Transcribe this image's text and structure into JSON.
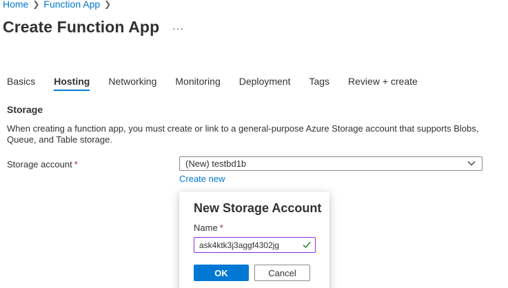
{
  "breadcrumb": {
    "items": [
      "Home",
      "Function App"
    ]
  },
  "header": {
    "title": "Create Function App",
    "more": "···"
  },
  "tabs": [
    {
      "label": "Basics",
      "active": false
    },
    {
      "label": "Hosting",
      "active": true
    },
    {
      "label": "Networking",
      "active": false
    },
    {
      "label": "Monitoring",
      "active": false
    },
    {
      "label": "Deployment",
      "active": false
    },
    {
      "label": "Tags",
      "active": false
    },
    {
      "label": "Review + create",
      "active": false
    }
  ],
  "storage": {
    "heading": "Storage",
    "description": "When creating a function app, you must create or link to a general-purpose Azure Storage account that supports Blobs, Queue, and Table storage.",
    "account_label": "Storage account",
    "required_mark": "*",
    "account_value": "(New) testbd1b",
    "create_new_link": "Create new"
  },
  "callout": {
    "title": "New Storage Account",
    "name_label": "Name",
    "required_mark": "*",
    "name_value": "ask4ktk3j3aggf4302jg",
    "ok_label": "OK",
    "cancel_label": "Cancel"
  },
  "colors": {
    "accent": "#0078d4",
    "valid_check": "#107c10",
    "required": "#a4262c",
    "input_focus_border": "#8a2be2"
  },
  "icons": {
    "breadcrumb_separator": "chevron-right-icon",
    "dropdown": "chevron-down-icon",
    "valid": "checkmark-icon"
  }
}
